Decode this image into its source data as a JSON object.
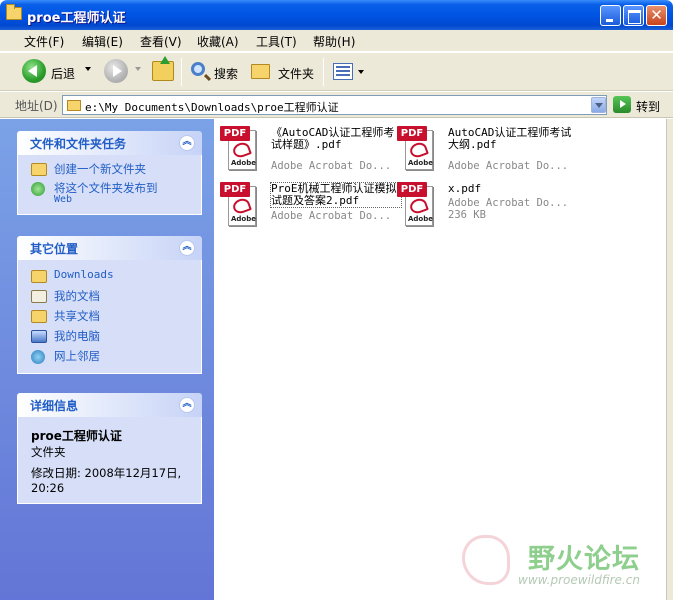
{
  "window": {
    "title": "proe工程师认证"
  },
  "menu": [
    "文件(F)",
    "编辑(E)",
    "查看(V)",
    "收藏(A)",
    "工具(T)",
    "帮助(H)"
  ],
  "toolbar": {
    "back": "后退",
    "search": "搜索",
    "folders": "文件夹"
  },
  "address": {
    "label": "地址(D)",
    "path": "e:\\My Documents\\Downloads\\proe工程师认证",
    "go": "转到"
  },
  "tasks": {
    "title": "文件和文件夹任务",
    "items": [
      "创建一个新文件夹",
      "将这个文件夹发布到",
      "Web"
    ]
  },
  "places": {
    "title": "其它位置",
    "items": [
      "Downloads",
      "我的文档",
      "共享文档",
      "我的电脑",
      "网上邻居"
    ]
  },
  "details": {
    "title": "详细信息",
    "name": "proe工程师认证",
    "type": "文件夹",
    "modified_label": "修改日期: 2008年12月17日,",
    "modified_time": "20:26"
  },
  "files": [
    {
      "name": "《AutoCAD认证工程师考试样题》.pdf",
      "type": "Adobe Acrobat Do..."
    },
    {
      "name": "AutoCAD认证工程师考试大纲.pdf",
      "type": "Adobe Acrobat Do..."
    },
    {
      "name": "ProE机械工程师认证模拟试题及答案2.pdf",
      "type": "Adobe Acrobat Do..."
    },
    {
      "name": "x.pdf",
      "type": "Adobe Acrobat Do...",
      "size": "236 KB"
    }
  ],
  "pdf_icon": {
    "badge": "PDF",
    "brand": "Adobe"
  },
  "watermark": {
    "text": "野火论坛",
    "url": "www.proewildfire.cn"
  },
  "colors": {
    "title_blue": "#0054e3",
    "pane_blue": "#6375d6",
    "link_blue": "#215dc6",
    "pdf_red": "#c8102e"
  }
}
